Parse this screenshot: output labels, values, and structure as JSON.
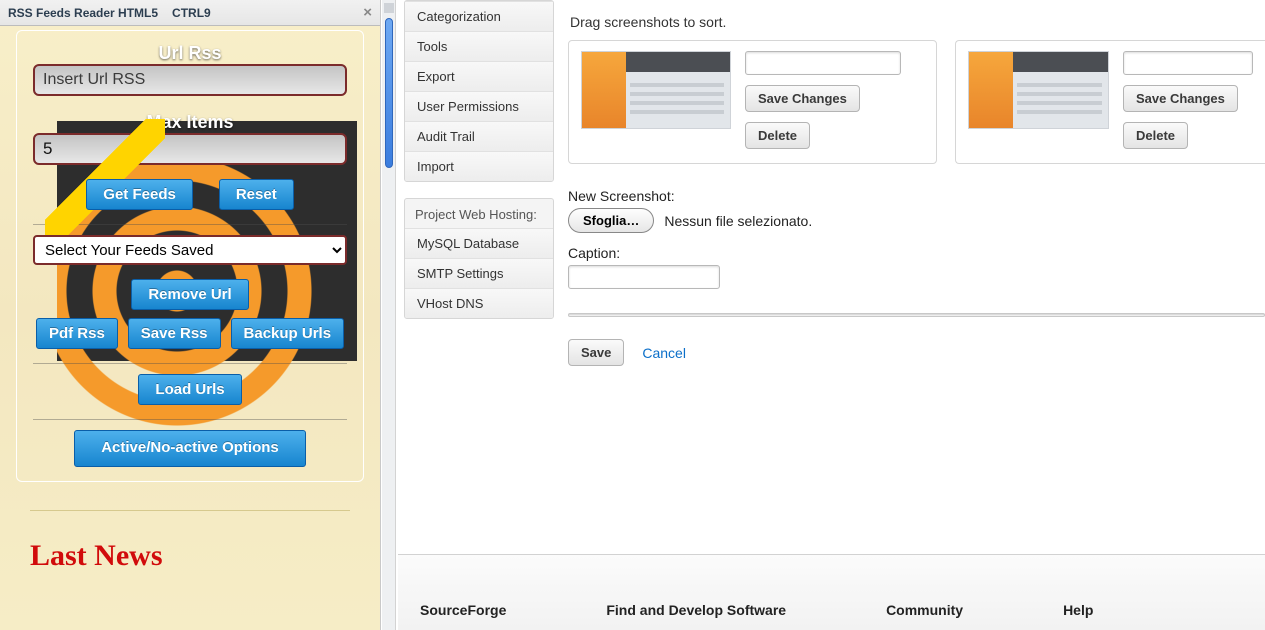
{
  "ext": {
    "title": "RSS Feeds Reader HTML5",
    "shortcut": "CTRL9",
    "url_label": "Url Rss",
    "url_placeholder": "Insert Url RSS",
    "max_label": "Max Items",
    "max_value": "5",
    "get_feeds": "Get Feeds",
    "reset": "Reset",
    "select_placeholder": "Select Your Feeds Saved",
    "remove_url": "Remove Url",
    "pdf_rss": "Pdf Rss",
    "save_rss": "Save Rss",
    "backup_urls": "Backup Urls",
    "load_urls": "Load Urls",
    "toggle_options": "Active/No-active Options",
    "last_news": "Last News"
  },
  "sf": {
    "instructions": "Drag screenshots to sort.",
    "sidebar_main": [
      "Categorization",
      "Tools",
      "Export",
      "User Permissions",
      "Audit Trail",
      "Import"
    ],
    "hosting_header": "Project Web Hosting:",
    "sidebar_hosting": [
      "MySQL Database",
      "SMTP Settings",
      "VHost DNS"
    ],
    "card": {
      "save_changes": "Save Changes",
      "delete": "Delete",
      "caption_value": ""
    },
    "new_shot_label": "New Screenshot:",
    "browse_label": "Sfoglia…",
    "file_status": "Nessun file selezionato.",
    "caption_label": "Caption:",
    "save": "Save",
    "cancel": "Cancel",
    "footer": {
      "c1": "SourceForge",
      "c2": "Find and Develop Software",
      "c3": "Community",
      "c4": "Help"
    }
  }
}
